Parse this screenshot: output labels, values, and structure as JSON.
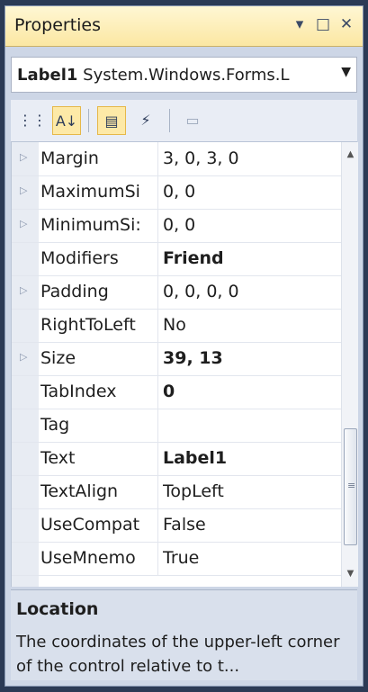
{
  "window": {
    "title": "Properties"
  },
  "titlebar": {
    "pin_glyph": "▾",
    "maximize_glyph": "□",
    "close_glyph": "✕"
  },
  "selector": {
    "object_name": "Label1",
    "object_type": "System.Windows.Forms.L",
    "dropdown_glyph": "▼"
  },
  "toolbar": {
    "categorized_glyph": "⋮⋮",
    "alphabetical_glyph": "A↓",
    "properties_glyph": "▤",
    "events_glyph": "⚡",
    "property_pages_glyph": "▭"
  },
  "properties": [
    {
      "name": "Margin",
      "value": "3, 0, 3, 0",
      "expandable": true,
      "bold": false
    },
    {
      "name": "MaximumSi",
      "value": "0, 0",
      "expandable": true,
      "bold": false
    },
    {
      "name": "MinimumSi:",
      "value": "0, 0",
      "expandable": true,
      "bold": false
    },
    {
      "name": "Modifiers",
      "value": "Friend",
      "expandable": false,
      "bold": true
    },
    {
      "name": "Padding",
      "value": "0, 0, 0, 0",
      "expandable": true,
      "bold": false
    },
    {
      "name": "RightToLeft",
      "value": "No",
      "expandable": false,
      "bold": false
    },
    {
      "name": "Size",
      "value": "39, 13",
      "expandable": true,
      "bold": true
    },
    {
      "name": "TabIndex",
      "value": "0",
      "expandable": false,
      "bold": true
    },
    {
      "name": "Tag",
      "value": "",
      "expandable": false,
      "bold": false
    },
    {
      "name": "Text",
      "value": "Label1",
      "expandable": false,
      "bold": true
    },
    {
      "name": "TextAlign",
      "value": "TopLeft",
      "expandable": false,
      "bold": false
    },
    {
      "name": "UseCompat",
      "value": "False",
      "expandable": false,
      "bold": false
    },
    {
      "name": "UseMnemo",
      "value": "True",
      "expandable": false,
      "bold": false
    }
  ],
  "description": {
    "title": "Location",
    "text": "The coordinates of the upper-left corner of the control relative to t..."
  },
  "colors": {
    "titlebar": "#fbe7a2",
    "panel": "#cdd6e6",
    "active_tool": "#fde9a7"
  }
}
